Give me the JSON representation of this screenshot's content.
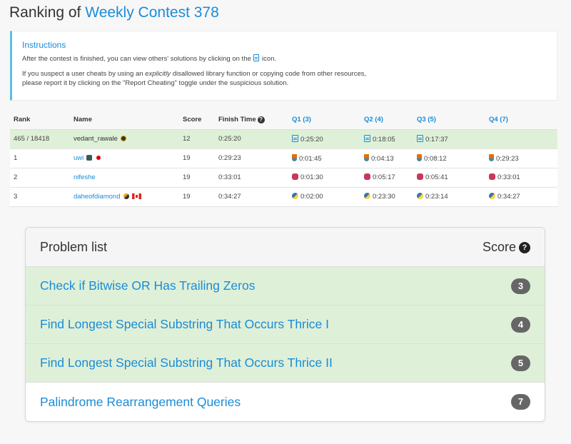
{
  "header": {
    "prefix": "Ranking of",
    "contest": "Weekly Contest 378"
  },
  "instructions": {
    "title": "Instructions",
    "line1_before": "After the contest is finished, you can view others' solutions by clicking on the",
    "line1_after": "icon.",
    "line2_before": "If you suspect a user cheats by using an",
    "line2_em": "explicitly",
    "line2_after": "disallowed library function or copying code from other resources,",
    "line3": "please report it by clicking on the \"Report Cheating\" toggle under the suspicious solution."
  },
  "ranking": {
    "columns": [
      "Rank",
      "Name",
      "Score",
      "Finish Time",
      "Q1 (3)",
      "Q2 (4)",
      "Q3 (5)",
      "Q4 (7)"
    ],
    "rows": [
      {
        "rank": "465 / 18418",
        "name": "vedant_rawale",
        "score": "12",
        "finish": "0:25:20",
        "q1": "0:25:20",
        "q2": "0:18:05",
        "q3": "0:17:37",
        "q4": ""
      },
      {
        "rank": "1",
        "name": "uwi",
        "score": "19",
        "finish": "0:29:23",
        "q1": "0:01:45",
        "q2": "0:04:13",
        "q3": "0:08:12",
        "q4": "0:29:23"
      },
      {
        "rank": "2",
        "name": "nifeshe",
        "score": "19",
        "finish": "0:33:01",
        "q1": "0:01:30",
        "q2": "0:05:17",
        "q3": "0:05:41",
        "q4": "0:33:01"
      },
      {
        "rank": "3",
        "name": "daheofdiamond",
        "score": "19",
        "finish": "0:34:27",
        "q1": "0:02:00",
        "q2": "0:23:30",
        "q3": "0:23:14",
        "q4": "0:34:27"
      }
    ],
    "icons": {
      "row0": "solution-doc-icon",
      "row1": "java-icon",
      "row2": "cpp-icon",
      "row3": "python-icon"
    }
  },
  "problems": {
    "header": "Problem list",
    "score_label": "Score",
    "help_glyph": "?",
    "items": [
      {
        "title": "Check if Bitwise OR Has Trailing Zeros",
        "score": "3",
        "solved": true
      },
      {
        "title": "Find Longest Special Substring That Occurs Thrice I",
        "score": "4",
        "solved": true
      },
      {
        "title": "Find Longest Special Substring That Occurs Thrice II",
        "score": "5",
        "solved": true
      },
      {
        "title": "Palindrome Rearrangement Queries",
        "score": "7",
        "solved": false
      }
    ]
  },
  "colors": {
    "accent": "#1a8cd8",
    "solved_bg": "#dff0d8",
    "info_border": "#5bc0de",
    "score_badge": "#666666"
  }
}
